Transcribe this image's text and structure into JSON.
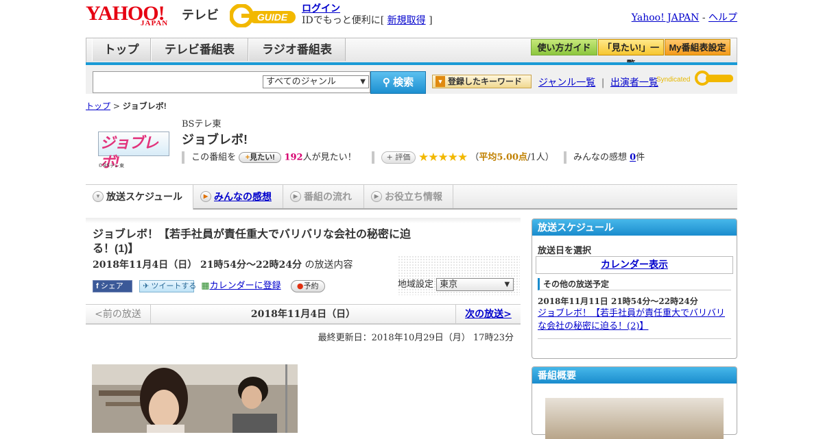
{
  "header": {
    "yahoo_logo": "YAHOO!",
    "yahoo_logo_sub": "JAPAN",
    "tv_label": "テレビ",
    "gguide_logo": "G GUIDE",
    "login": "ログイン",
    "login_msg": "IDでもっと便利に[",
    "register": "新規取得",
    "login_msg_end": "]",
    "yahoo_japan": "Yahoo! JAPAN",
    "dash": "-",
    "help": "ヘルプ"
  },
  "gnav": {
    "tabs": [
      "トップ",
      "テレビ番組表",
      "ラジオ番組表"
    ],
    "buttons": [
      "使い方ガイド",
      "「見たい!」一覧",
      "My番組表設定"
    ]
  },
  "search": {
    "input_value": "",
    "genre": "すべてのジャンル",
    "button": "検索",
    "keyword_button": "登録したキーワード",
    "genre_list": "ジャンル一覧",
    "separator": "|",
    "performers": "出演者一覧",
    "syndicated": "Syndicated"
  },
  "breadcrumb": {
    "top": "トップ",
    "sep": ">",
    "current": "ジョブレボ!"
  },
  "program": {
    "logo_text": "ジョブレボ!",
    "logo_caption": "©BSテレ東",
    "channel": "BSテレ東",
    "title": "ジョブレボ!",
    "want_prefix": "この番組を",
    "want_button": "見たい!",
    "want_count": "192",
    "want_suffix": "人が見たい！",
    "rate_button": "評価",
    "stars": "★★★★★",
    "rating_open": "（",
    "rating_avg": "平均5.00点",
    "rating_people": "/1人）",
    "impressions_label": "みんなの感想",
    "impressions_count": "0",
    "impressions_suffix": "件"
  },
  "tabs": [
    "放送スケジュール",
    "みんなの感想",
    "番組の流れ",
    "お役立ち情報"
  ],
  "episode": {
    "title": "ジョブレボ！【若手社員が責任重大でバリバリな会社の秘密に迫る！(1)】",
    "date": "2018年11月4日（日） 21時54分～22時24分",
    "date_suffix": "の放送内容",
    "share_fb": "シェア",
    "share_tw": "ツイートする",
    "calendar": "カレンダーに登録",
    "reserve": "予約",
    "region_label": "地域設定",
    "region": "東京"
  },
  "navbar": {
    "prev": "<前の放送",
    "date": "2018年11月4日（日）",
    "next": "次の放送>"
  },
  "updated": "最終更新日：2018年10月29日（月） 17時23分",
  "sidebar": {
    "schedule_header": "放送スケジュール",
    "select_date": "放送日を選択",
    "calendar_button": "カレンダー表示",
    "other_header": "その他の放送予定",
    "other_date": "2018年11月11日 21時54分～22時24分",
    "other_title": "ジョブレボ！【若手社員が責任重大でバリバリな会社の秘密に迫る！(2)】",
    "summary_header": "番組概要"
  },
  "colors": {
    "accent_blue": "#1a9ad6",
    "yahoo_red": "#e60012",
    "link_blue": "#0000cc",
    "star_gold": "#f2b800"
  }
}
